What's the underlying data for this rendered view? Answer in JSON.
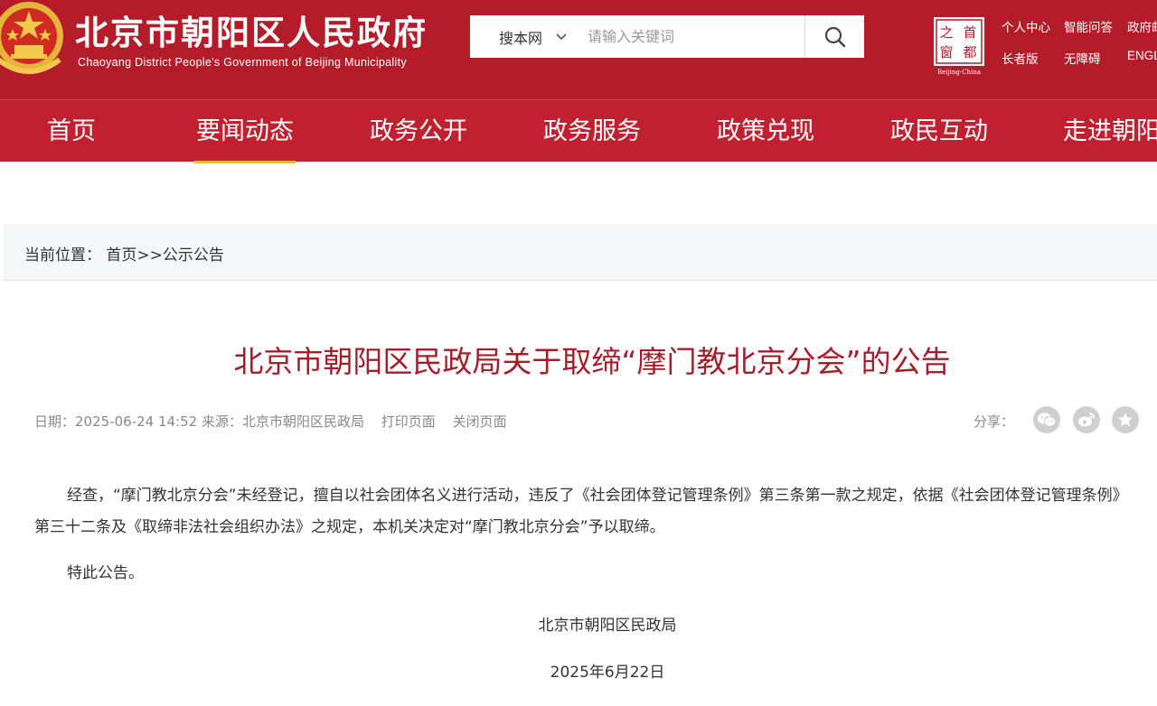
{
  "colors": {
    "brand_red": "#b51c2a",
    "nav_red": "#c0202f",
    "title_red": "#a61e2a",
    "nav_active_underline": "#e9b949",
    "breadcrumb_bg": "#f5f6f8"
  },
  "header": {
    "site_title": "北京市朝阳区人民政府",
    "site_subtitle": "Chaoyang District People's Government of Beijing Municipality",
    "emblem_icon": "national-emblem-icon",
    "search": {
      "scope": "搜本网",
      "placeholder": "请输入关键词",
      "button_icon": "search-icon"
    },
    "capital_logo": {
      "chars": [
        "之",
        "首",
        "窗",
        "都"
      ],
      "caption": "Beijing-China"
    },
    "top_links": [
      "个人中心",
      "智能问答",
      "政府邮",
      "长者版",
      "无障碍",
      "ENGL"
    ]
  },
  "nav": {
    "items": [
      "首页",
      "要闻动态",
      "政务公开",
      "政务服务",
      "政策兑现",
      "政民互动",
      "走进朝阳"
    ],
    "active": "要闻动态"
  },
  "breadcrumb": {
    "label": "当前位置：",
    "home": "首页",
    "separator": ">>",
    "current": "公示公告"
  },
  "article": {
    "title": "北京市朝阳区民政局关于取缔“摩门教北京分会”的公告",
    "date_label": "日期：",
    "date": "2025-06-24 14:52",
    "source_label": "来源：",
    "source": "北京市朝阳区民政局",
    "print": "打印页面",
    "close": "关闭页面",
    "share_label": "分享：",
    "share_icons": [
      "wechat-icon",
      "weibo-icon",
      "favorite-star-icon"
    ],
    "paragraphs": [
      "经查，“摩门教北京分会”未经登记，擅自以社会团体名义进行活动，违反了《社会团体登记管理条例》第三条第一款之规定，依据《社会团体登记管理条例》第三十二条及《取缔非法社会组织办法》之规定，本机关决定对“摩门教北京分会”予以取缔。",
      "特此公告。"
    ],
    "signature_org": "北京市朝阳区民政局",
    "signature_date": "2025年6月22日"
  }
}
